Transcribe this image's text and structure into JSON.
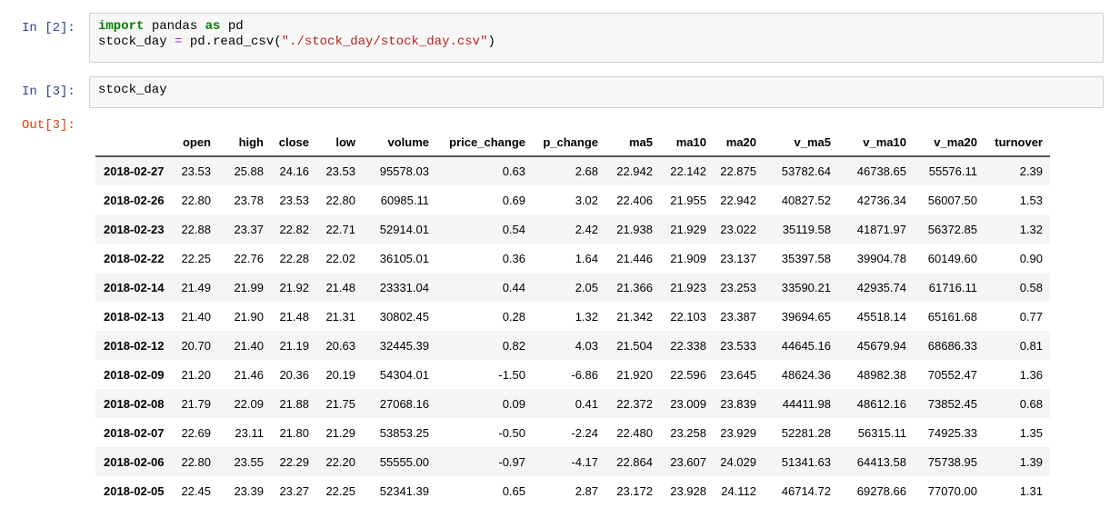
{
  "cells": [
    {
      "prompt": "In [2]:",
      "code": [
        [
          {
            "t": "import",
            "c": "kw"
          },
          {
            "t": " pandas ",
            "c": ""
          },
          {
            "t": "as",
            "c": "kw"
          },
          {
            "t": " pd",
            "c": ""
          }
        ],
        [
          {
            "t": "stock_day ",
            "c": ""
          },
          {
            "t": "=",
            "c": "op"
          },
          {
            "t": " pd.read_csv(",
            "c": ""
          },
          {
            "t": "\"./stock_day/stock_day.csv\"",
            "c": "str"
          },
          {
            "t": ")",
            "c": ""
          }
        ]
      ]
    },
    {
      "prompt": "In [3]:",
      "code": [
        [
          {
            "t": "stock_day",
            "c": ""
          }
        ]
      ]
    }
  ],
  "output": {
    "prompt": "Out[3]:",
    "columns": [
      "",
      "open",
      "high",
      "close",
      "low",
      "volume",
      "price_change",
      "p_change",
      "ma5",
      "ma10",
      "ma20",
      "v_ma5",
      "v_ma10",
      "v_ma20",
      "turnover"
    ],
    "rows": [
      [
        "2018-02-27",
        "23.53",
        "25.88",
        "24.16",
        "23.53",
        "95578.03",
        "0.63",
        "2.68",
        "22.942",
        "22.142",
        "22.875",
        "53782.64",
        "46738.65",
        "55576.11",
        "2.39"
      ],
      [
        "2018-02-26",
        "22.80",
        "23.78",
        "23.53",
        "22.80",
        "60985.11",
        "0.69",
        "3.02",
        "22.406",
        "21.955",
        "22.942",
        "40827.52",
        "42736.34",
        "56007.50",
        "1.53"
      ],
      [
        "2018-02-23",
        "22.88",
        "23.37",
        "22.82",
        "22.71",
        "52914.01",
        "0.54",
        "2.42",
        "21.938",
        "21.929",
        "23.022",
        "35119.58",
        "41871.97",
        "56372.85",
        "1.32"
      ],
      [
        "2018-02-22",
        "22.25",
        "22.76",
        "22.28",
        "22.02",
        "36105.01",
        "0.36",
        "1.64",
        "21.446",
        "21.909",
        "23.137",
        "35397.58",
        "39904.78",
        "60149.60",
        "0.90"
      ],
      [
        "2018-02-14",
        "21.49",
        "21.99",
        "21.92",
        "21.48",
        "23331.04",
        "0.44",
        "2.05",
        "21.366",
        "21.923",
        "23.253",
        "33590.21",
        "42935.74",
        "61716.11",
        "0.58"
      ],
      [
        "2018-02-13",
        "21.40",
        "21.90",
        "21.48",
        "21.31",
        "30802.45",
        "0.28",
        "1.32",
        "21.342",
        "22.103",
        "23.387",
        "39694.65",
        "45518.14",
        "65161.68",
        "0.77"
      ],
      [
        "2018-02-12",
        "20.70",
        "21.40",
        "21.19",
        "20.63",
        "32445.39",
        "0.82",
        "4.03",
        "21.504",
        "22.338",
        "23.533",
        "44645.16",
        "45679.94",
        "68686.33",
        "0.81"
      ],
      [
        "2018-02-09",
        "21.20",
        "21.46",
        "20.36",
        "20.19",
        "54304.01",
        "-1.50",
        "-6.86",
        "21.920",
        "22.596",
        "23.645",
        "48624.36",
        "48982.38",
        "70552.47",
        "1.36"
      ],
      [
        "2018-02-08",
        "21.79",
        "22.09",
        "21.88",
        "21.75",
        "27068.16",
        "0.09",
        "0.41",
        "22.372",
        "23.009",
        "23.839",
        "44411.98",
        "48612.16",
        "73852.45",
        "0.68"
      ],
      [
        "2018-02-07",
        "22.69",
        "23.11",
        "21.80",
        "21.29",
        "53853.25",
        "-0.50",
        "-2.24",
        "22.480",
        "23.258",
        "23.929",
        "52281.28",
        "56315.11",
        "74925.33",
        "1.35"
      ],
      [
        "2018-02-06",
        "22.80",
        "23.55",
        "22.29",
        "22.20",
        "55555.00",
        "-0.97",
        "-4.17",
        "22.864",
        "23.607",
        "24.029",
        "51341.63",
        "64413.58",
        "75738.95",
        "1.39"
      ],
      [
        "2018-02-05",
        "22.45",
        "23.39",
        "23.27",
        "22.25",
        "52341.39",
        "0.65",
        "2.87",
        "23.172",
        "23.928",
        "24.112",
        "46714.72",
        "69278.66",
        "77070.00",
        "1.31"
      ]
    ]
  }
}
